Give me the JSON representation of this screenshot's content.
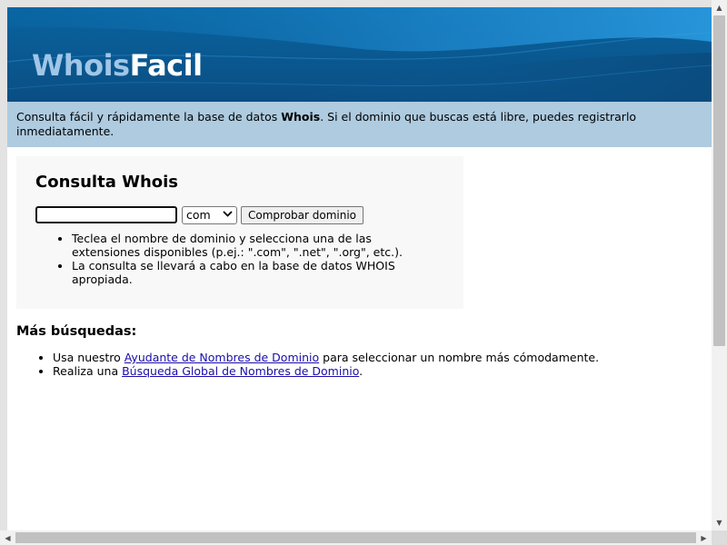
{
  "header": {
    "logo_part1": "Whois",
    "logo_part2": "Facil"
  },
  "intro": {
    "text_before": "Consulta fácil y rápidamente la base de datos ",
    "bold": "Whois",
    "text_after": ". Si el dominio que buscas está libre, puedes registrarlo inmediatamente."
  },
  "whois_panel": {
    "title": "Consulta Whois",
    "domain_input_value": "",
    "extension_selected": "com",
    "check_button": "Comprobar dominio",
    "tips": [
      "Teclea el nombre de dominio y selecciona una de las extensiones disponibles (p.ej.: \".com\", \".net\", \".org\", etc.).",
      "La consulta se llevará a cabo en la base de datos WHOIS apropiada."
    ]
  },
  "more_searches": {
    "title": "Más búsquedas:",
    "item1_before": "Usa nuestro ",
    "item1_link": "Ayudante de Nombres de Dominio",
    "item1_after": " para seleccionar un nombre más cómodamente.",
    "item2_before": "Realiza una ",
    "item2_link": "Búsqueda Global de Nombres de Dominio",
    "item2_after": "."
  },
  "icons": {
    "scroll_up": "▲",
    "scroll_down": "▼",
    "scroll_left": "◀",
    "scroll_right": "▶",
    "select_chevron": "⌄"
  },
  "colors": {
    "banner": "#0a5a93",
    "intro_bg": "#aecbe0",
    "panel_bg": "#f8f8f8",
    "link": "#1a0dab"
  }
}
